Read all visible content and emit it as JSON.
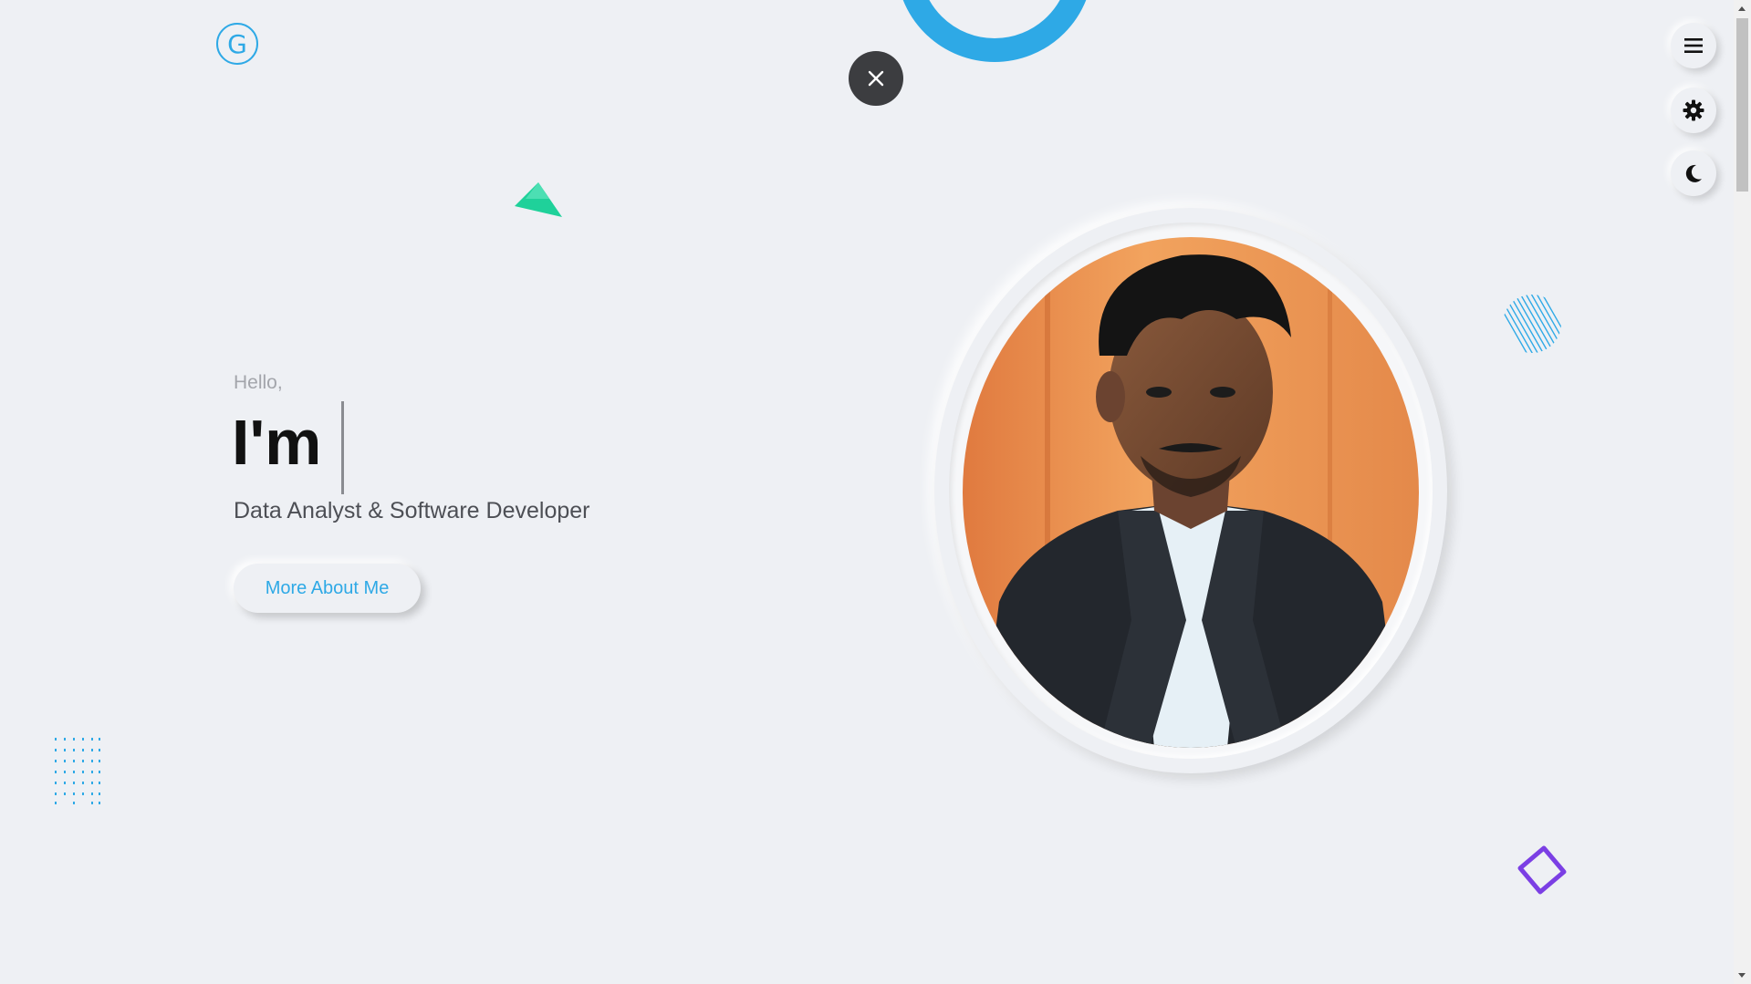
{
  "logo": {
    "letter": "G"
  },
  "hero": {
    "greeting": "Hello,",
    "intro": "I'm",
    "role": "Data Analyst & Software Developer",
    "cta_label": "More About Me"
  },
  "controls": {
    "close_icon": "close-icon",
    "menu_icon": "hamburger-menu-icon",
    "settings_icon": "gear-icon",
    "theme_icon": "moon-icon"
  },
  "colors": {
    "accent": "#2ea9e6",
    "background": "#eef0f4",
    "triangle": "#1fd19a",
    "diamond": "#7b3fe4",
    "close_bg": "#3c3d40"
  }
}
